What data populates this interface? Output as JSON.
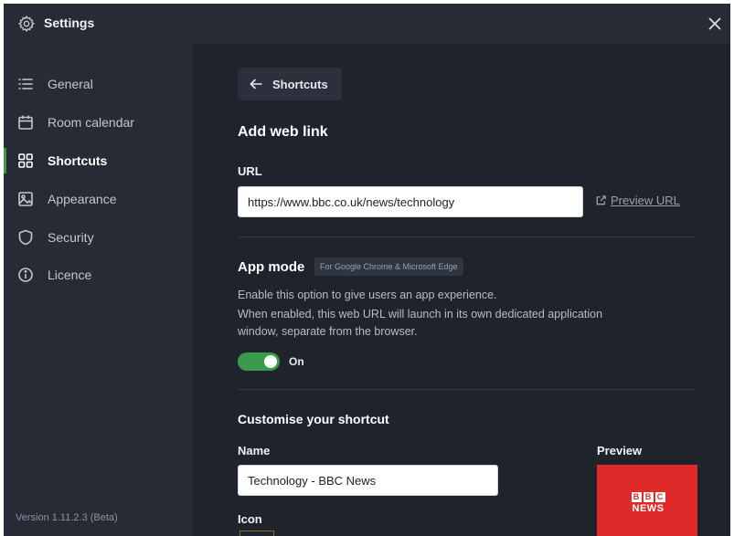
{
  "window": {
    "title": "Settings"
  },
  "sidebar": {
    "items": [
      {
        "label": "General",
        "icon": "list-icon",
        "active": false
      },
      {
        "label": "Room calendar",
        "icon": "calendar-icon",
        "active": false
      },
      {
        "label": "Shortcuts",
        "icon": "grid-icon",
        "active": true
      },
      {
        "label": "Appearance",
        "icon": "image-icon",
        "active": false
      },
      {
        "label": "Security",
        "icon": "shield-icon",
        "active": false
      },
      {
        "label": "Licence",
        "icon": "info-icon",
        "active": false
      }
    ],
    "version": "Version 1.11.2.3 (Beta)"
  },
  "main": {
    "back_label": "Shortcuts",
    "heading": "Add web link",
    "url_label": "URL",
    "url_value": "https://www.bbc.co.uk/news/technology",
    "preview_url_label": "Preview URL",
    "app_mode": {
      "title": "App mode",
      "badge": "For Google Chrome & Microsoft Edge",
      "desc_line1": "Enable this option to give users an app experience.",
      "desc_line2": "When enabled, this web URL will launch in its own dedicated application",
      "desc_line3": "window, separate from the browser.",
      "toggle_label": "On"
    },
    "customise": {
      "title": "Customise your shortcut",
      "name_label": "Name",
      "name_value": "Technology - BBC News",
      "preview_label": "Preview",
      "icon_label": "Icon",
      "tile_logo": {
        "letters": [
          "B",
          "B",
          "C"
        ],
        "word": "NEWS"
      }
    }
  },
  "colors": {
    "accent_green": "#3c9a4c",
    "tile_red": "#e02a2a",
    "sidebar_bg": "#262b36",
    "main_bg": "#1f232c"
  }
}
